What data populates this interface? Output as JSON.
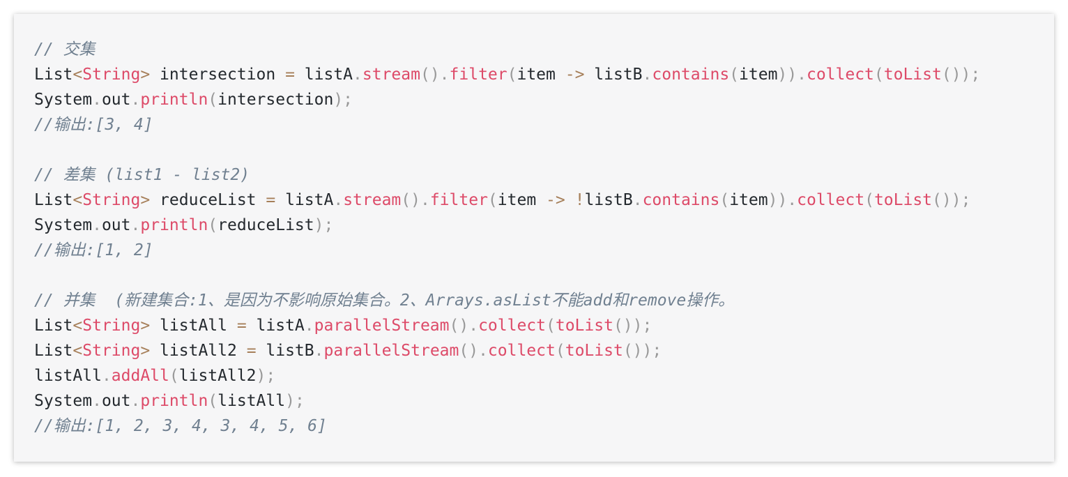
{
  "code_snippet": {
    "language": "java",
    "lines": [
      [
        {
          "t": "comment",
          "v": "// 交集"
        }
      ],
      [
        {
          "t": "plain",
          "v": "List"
        },
        {
          "t": "op",
          "v": "<"
        },
        {
          "t": "func",
          "v": "String"
        },
        {
          "t": "op",
          "v": ">"
        },
        {
          "t": "plain",
          "v": " intersection "
        },
        {
          "t": "op",
          "v": "="
        },
        {
          "t": "plain",
          "v": " listA"
        },
        {
          "t": "punct",
          "v": "."
        },
        {
          "t": "func",
          "v": "stream"
        },
        {
          "t": "punct",
          "v": "()."
        },
        {
          "t": "func",
          "v": "filter"
        },
        {
          "t": "punct",
          "v": "("
        },
        {
          "t": "plain",
          "v": "item "
        },
        {
          "t": "op",
          "v": "->"
        },
        {
          "t": "plain",
          "v": " listB"
        },
        {
          "t": "punct",
          "v": "."
        },
        {
          "t": "func",
          "v": "contains"
        },
        {
          "t": "punct",
          "v": "("
        },
        {
          "t": "plain",
          "v": "item"
        },
        {
          "t": "punct",
          "v": "))."
        },
        {
          "t": "func",
          "v": "collect"
        },
        {
          "t": "punct",
          "v": "("
        },
        {
          "t": "func",
          "v": "toList"
        },
        {
          "t": "punct",
          "v": "());"
        }
      ],
      [
        {
          "t": "plain",
          "v": "System"
        },
        {
          "t": "punct",
          "v": "."
        },
        {
          "t": "plain",
          "v": "out"
        },
        {
          "t": "punct",
          "v": "."
        },
        {
          "t": "func",
          "v": "println"
        },
        {
          "t": "punct",
          "v": "("
        },
        {
          "t": "plain",
          "v": "intersection"
        },
        {
          "t": "punct",
          "v": ");"
        }
      ],
      [
        {
          "t": "comment",
          "v": "//输出:[3, 4]"
        }
      ],
      [],
      [
        {
          "t": "comment",
          "v": "// 差集 (list1 - list2)"
        }
      ],
      [
        {
          "t": "plain",
          "v": "List"
        },
        {
          "t": "op",
          "v": "<"
        },
        {
          "t": "func",
          "v": "String"
        },
        {
          "t": "op",
          "v": ">"
        },
        {
          "t": "plain",
          "v": " reduceList "
        },
        {
          "t": "op",
          "v": "="
        },
        {
          "t": "plain",
          "v": " listA"
        },
        {
          "t": "punct",
          "v": "."
        },
        {
          "t": "func",
          "v": "stream"
        },
        {
          "t": "punct",
          "v": "()."
        },
        {
          "t": "func",
          "v": "filter"
        },
        {
          "t": "punct",
          "v": "("
        },
        {
          "t": "plain",
          "v": "item "
        },
        {
          "t": "op",
          "v": "->"
        },
        {
          "t": "plain",
          "v": " "
        },
        {
          "t": "op",
          "v": "!"
        },
        {
          "t": "plain",
          "v": "listB"
        },
        {
          "t": "punct",
          "v": "."
        },
        {
          "t": "func",
          "v": "contains"
        },
        {
          "t": "punct",
          "v": "("
        },
        {
          "t": "plain",
          "v": "item"
        },
        {
          "t": "punct",
          "v": "))."
        },
        {
          "t": "func",
          "v": "collect"
        },
        {
          "t": "punct",
          "v": "("
        },
        {
          "t": "func",
          "v": "toList"
        },
        {
          "t": "punct",
          "v": "());"
        }
      ],
      [
        {
          "t": "plain",
          "v": "System"
        },
        {
          "t": "punct",
          "v": "."
        },
        {
          "t": "plain",
          "v": "out"
        },
        {
          "t": "punct",
          "v": "."
        },
        {
          "t": "func",
          "v": "println"
        },
        {
          "t": "punct",
          "v": "("
        },
        {
          "t": "plain",
          "v": "reduceList"
        },
        {
          "t": "punct",
          "v": ");"
        }
      ],
      [
        {
          "t": "comment",
          "v": "//输出:[1, 2]"
        }
      ],
      [],
      [
        {
          "t": "comment",
          "v": "// 并集  (新建集合:1、是因为不影响原始集合。2、Arrays.asList不能add和remove操作。"
        }
      ],
      [
        {
          "t": "plain",
          "v": "List"
        },
        {
          "t": "op",
          "v": "<"
        },
        {
          "t": "func",
          "v": "String"
        },
        {
          "t": "op",
          "v": ">"
        },
        {
          "t": "plain",
          "v": " listAll "
        },
        {
          "t": "op",
          "v": "="
        },
        {
          "t": "plain",
          "v": " listA"
        },
        {
          "t": "punct",
          "v": "."
        },
        {
          "t": "func",
          "v": "parallelStream"
        },
        {
          "t": "punct",
          "v": "()."
        },
        {
          "t": "func",
          "v": "collect"
        },
        {
          "t": "punct",
          "v": "("
        },
        {
          "t": "func",
          "v": "toList"
        },
        {
          "t": "punct",
          "v": "());"
        }
      ],
      [
        {
          "t": "plain",
          "v": "List"
        },
        {
          "t": "op",
          "v": "<"
        },
        {
          "t": "func",
          "v": "String"
        },
        {
          "t": "op",
          "v": ">"
        },
        {
          "t": "plain",
          "v": " listAll2 "
        },
        {
          "t": "op",
          "v": "="
        },
        {
          "t": "plain",
          "v": " listB"
        },
        {
          "t": "punct",
          "v": "."
        },
        {
          "t": "func",
          "v": "parallelStream"
        },
        {
          "t": "punct",
          "v": "()."
        },
        {
          "t": "func",
          "v": "collect"
        },
        {
          "t": "punct",
          "v": "("
        },
        {
          "t": "func",
          "v": "toList"
        },
        {
          "t": "punct",
          "v": "());"
        }
      ],
      [
        {
          "t": "plain",
          "v": "listAll"
        },
        {
          "t": "punct",
          "v": "."
        },
        {
          "t": "func",
          "v": "addAll"
        },
        {
          "t": "punct",
          "v": "("
        },
        {
          "t": "plain",
          "v": "listAll2"
        },
        {
          "t": "punct",
          "v": ");"
        }
      ],
      [
        {
          "t": "plain",
          "v": "System"
        },
        {
          "t": "punct",
          "v": "."
        },
        {
          "t": "plain",
          "v": "out"
        },
        {
          "t": "punct",
          "v": "."
        },
        {
          "t": "func",
          "v": "println"
        },
        {
          "t": "punct",
          "v": "("
        },
        {
          "t": "plain",
          "v": "listAll"
        },
        {
          "t": "punct",
          "v": ");"
        }
      ],
      [
        {
          "t": "comment",
          "v": "//输出:[1, 2, 3, 4, 3, 4, 5, 6]"
        }
      ]
    ]
  },
  "colors": {
    "panel_background": "#f6f6f7",
    "page_background": "#ffffff",
    "plain": "#24292e",
    "punctuation": "#999999",
    "function": "#dd4a68",
    "operator": "#a67f59",
    "comment": "#708090"
  }
}
